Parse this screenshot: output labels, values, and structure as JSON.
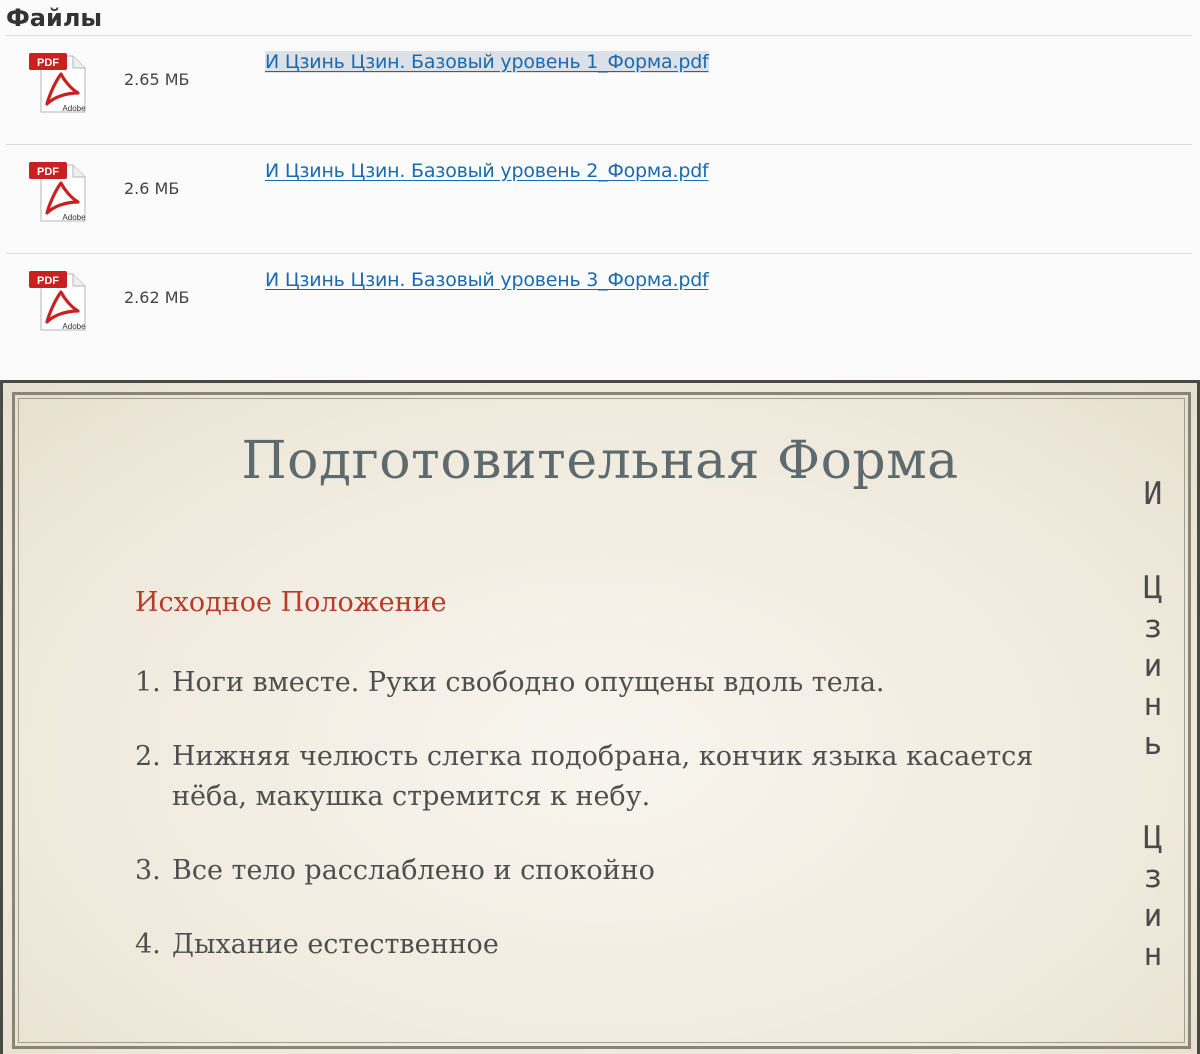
{
  "files_panel": {
    "title": "Файлы",
    "icon_badge": "PDF",
    "icon_brand": "Adobe",
    "files": [
      {
        "size": "2.65 МБ",
        "name": "И Цзинь Цзин. Базовый уровень 1_Форма.pdf"
      },
      {
        "size": "2.6 МБ",
        "name": "И Цзинь Цзин. Базовый уровень 2_Форма.pdf"
      },
      {
        "size": "2.62 МБ",
        "name": "И Цзинь Цзин. Базовый уровень 3_Форма.pdf"
      }
    ]
  },
  "slide": {
    "title": "Подготовительная Форма",
    "subtitle": "Исходное Положение",
    "steps": [
      {
        "num": "1.",
        "text": "Ноги вместе. Руки свободно опущены вдоль тела."
      },
      {
        "num": "2.",
        "text": "Нижняя челюсть слегка подобрана, кончик языка касается нёба, макушка стремится к небу."
      },
      {
        "num": "3.",
        "text": "Все тело расслаблено и спокойно"
      },
      {
        "num": "4.",
        "text": "Дыхание естественное"
      }
    ],
    "vertical_text": "И Цзинь Цзин"
  },
  "colors": {
    "link": "#1a6ab0",
    "title": "#5d6b6e",
    "subtitle": "#b83c2a",
    "pdf_red": "#c8211f"
  }
}
